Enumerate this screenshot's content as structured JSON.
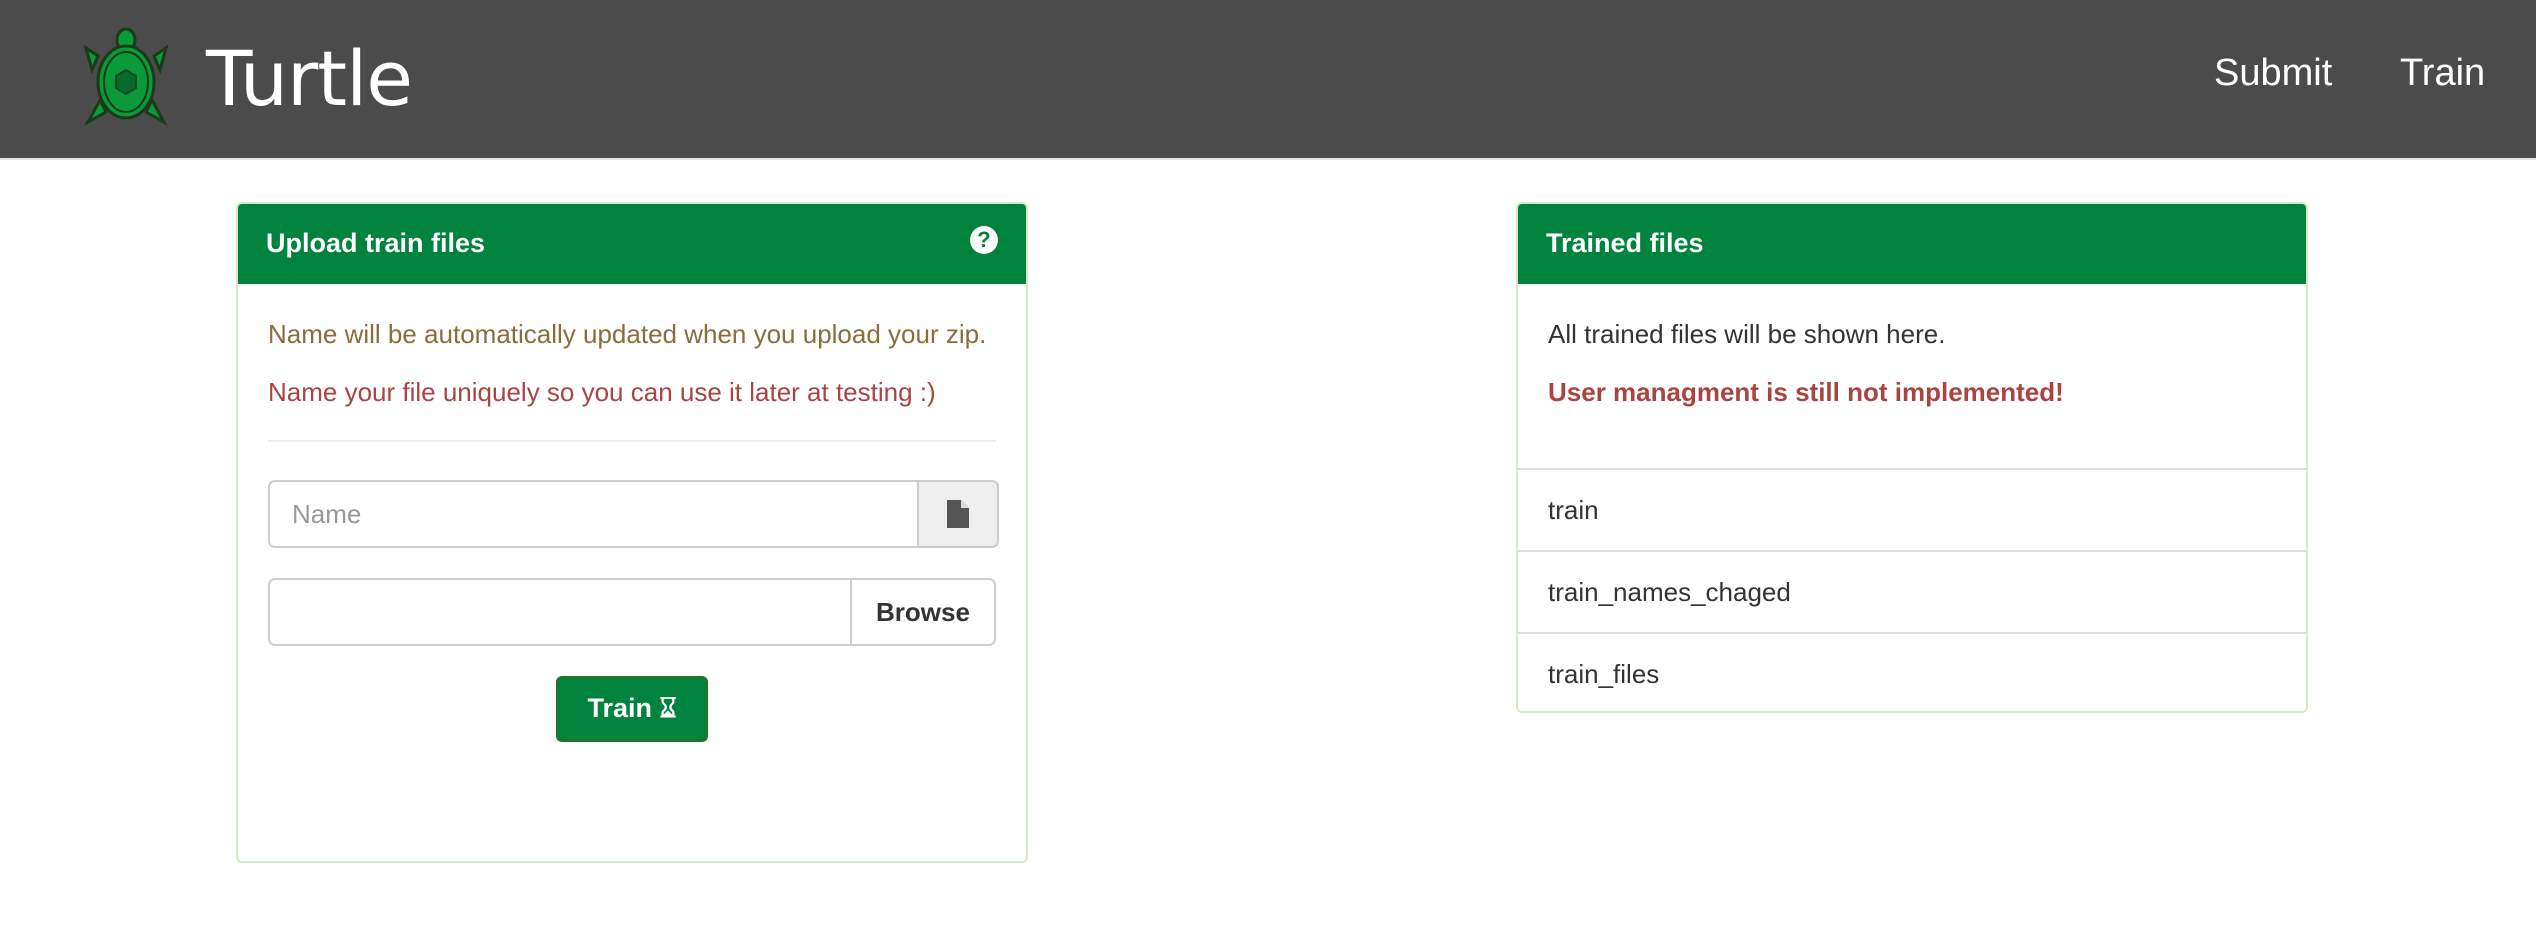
{
  "header": {
    "brand": "Turtle",
    "nav": [
      "Submit",
      "Train"
    ]
  },
  "upload_panel": {
    "title": "Upload train files",
    "help_icon": "question-circle-icon",
    "info": "Name will be automatically updated when you upload your zip.",
    "warning": "Name your file uniquely so you can use it later at testing :)",
    "name_placeholder": "Name",
    "name_value": "",
    "file_icon": "file-icon",
    "browse_label": "Browse",
    "train_label": "Train",
    "train_icon": "hourglass-icon"
  },
  "trained_panel": {
    "title": "Trained files",
    "info": "All trained files will be shown here.",
    "warning": "User managment is still not implemented!",
    "files": [
      "train",
      "train_names_chaged",
      "train_files"
    ]
  },
  "colors": {
    "header": "#4b4b4b",
    "brand_green": "#00843d",
    "warning": "#8a6d3b",
    "danger": "#a94442"
  }
}
